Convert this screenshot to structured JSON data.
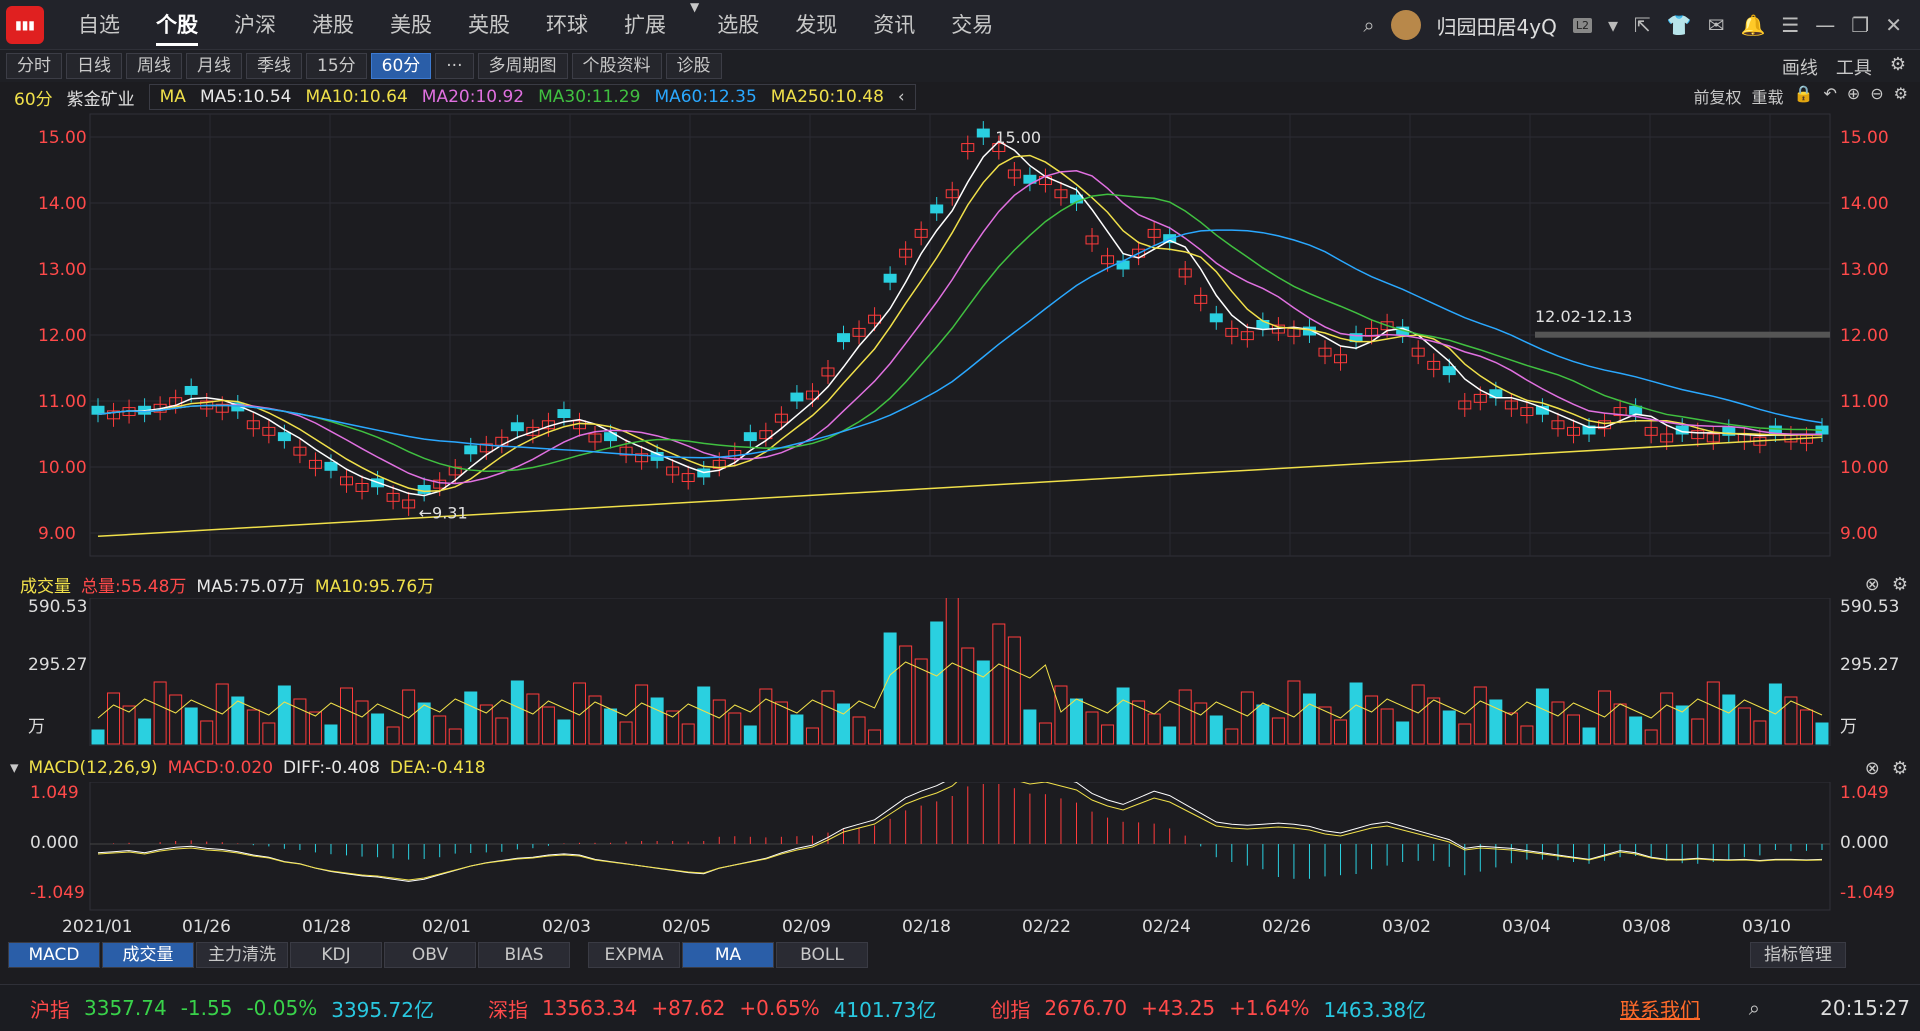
{
  "nav": {
    "tabs": [
      "自选",
      "个股",
      "沪深",
      "港股",
      "美股",
      "英股",
      "环球",
      "扩展",
      "选股",
      "发现",
      "资讯",
      "交易"
    ],
    "active": 1,
    "user": "归园田居4yQ",
    "badge": "L2"
  },
  "periods": {
    "items": [
      "分时",
      "日线",
      "周线",
      "月线",
      "季线",
      "15分",
      "60分",
      "···",
      "多周期图",
      "个股资料",
      "诊股"
    ],
    "selected": 6
  },
  "tools": {
    "draw": "画线",
    "tools": "工具"
  },
  "stock": {
    "period": "60分",
    "name": "紫金矿业",
    "ma_title": "MA",
    "ma5": "MA5:10.54",
    "ma10": "MA10:10.64",
    "ma20": "MA20:10.92",
    "ma30": "MA30:11.29",
    "ma60": "MA60:12.35",
    "ma250": "MA250:10.48",
    "right1": "前复权",
    "right2": "重载"
  },
  "price_axis": {
    "labels": [
      "15.00",
      "14.00",
      "13.00",
      "12.00",
      "11.00",
      "10.00",
      "9.00"
    ],
    "high": "15.00",
    "low": "9.31",
    "range": "12.02-12.13"
  },
  "volume": {
    "title": "成交量",
    "total": "总量:55.48万",
    "ma5": "MA5:75.07万",
    "ma10": "MA10:95.76万",
    "labels": [
      "590.53",
      "295.27",
      "万"
    ]
  },
  "macd": {
    "title": "MACD(12,26,9)",
    "val": "MACD:0.020",
    "diff": "DIFF:-0.408",
    "dea": "DEA:-0.418",
    "labels": [
      "1.049",
      "0.000",
      "-1.049"
    ]
  },
  "dates": [
    "2021/01",
    "01/26",
    "01/28",
    "02/01",
    "02/03",
    "02/05",
    "02/09",
    "02/18",
    "02/22",
    "02/24",
    "02/26",
    "03/02",
    "03/04",
    "03/08",
    "03/10"
  ],
  "indicator_tabs": {
    "left": [
      "MACD",
      "成交量",
      "主力清洗",
      "KDJ",
      "OBV",
      "BIAS"
    ],
    "right": [
      "EXPMA",
      "MA",
      "BOLL"
    ],
    "manage": "指标管理"
  },
  "status": {
    "sh_name": "沪指",
    "sh_val": "3357.74",
    "sh_chg": "-1.55",
    "sh_pct": "-0.05%",
    "sh_amt": "3395.72亿",
    "sz_name": "深指",
    "sz_val": "13563.34",
    "sz_chg": "+87.62",
    "sz_pct": "+0.65%",
    "sz_amt": "4101.73亿",
    "cy_name": "创指",
    "cy_val": "2676.70",
    "cy_chg": "+43.25",
    "cy_pct": "+1.64%",
    "cy_amt": "1463.38亿",
    "contact": "联系我们",
    "time": "20:15:27"
  }
}
